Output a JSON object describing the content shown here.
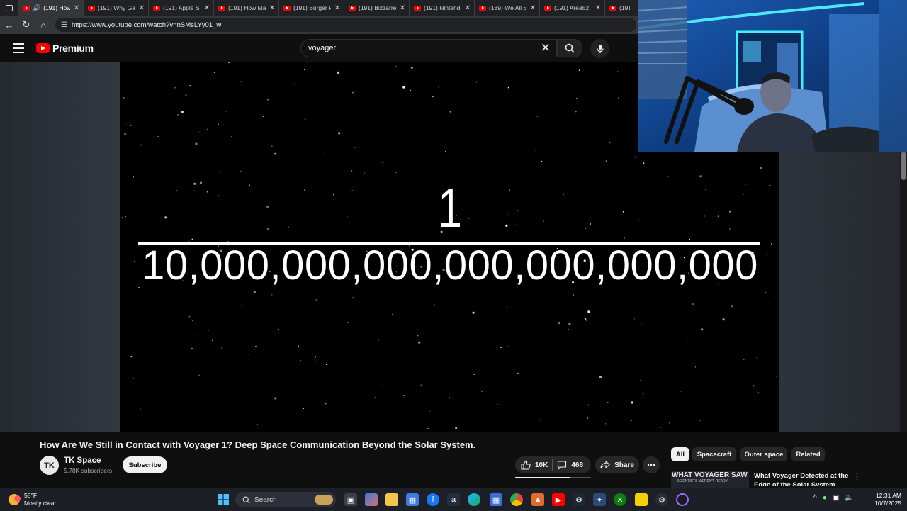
{
  "browser": {
    "tabs": [
      {
        "title": "(191) How",
        "active": true,
        "audio": true
      },
      {
        "title": "(191) Why Ga"
      },
      {
        "title": "(191) Apple S"
      },
      {
        "title": "(191) How Ma"
      },
      {
        "title": "(191) Burger P"
      },
      {
        "title": "(191) Bizzarre"
      },
      {
        "title": "(191) Nintend"
      },
      {
        "title": "(189) We All S"
      },
      {
        "title": "(191) Area52"
      },
      {
        "title": "(191)"
      }
    ],
    "url": "https://www.youtube.com/watch?v=nSMsLYy01_w"
  },
  "youtube": {
    "logo_text": "Premium",
    "search_value": "voyager"
  },
  "video": {
    "numerator": "1",
    "denominator": "10,000,000,000,000,000,000,000",
    "title": "How Are We Still in Contact with Voyager 1? Deep Space Communication Beyond the Solar System.",
    "channel": {
      "avatar_text": "TK",
      "name": "TK Space",
      "subscribers": "5.78K subscribers",
      "subscribe_label": "Subscribe"
    },
    "likes": "10K",
    "like_ratio": 0.73,
    "comments": "468",
    "share_label": "Share"
  },
  "recommendations": {
    "chips": [
      "All",
      "Spacecraft",
      "Outer space",
      "Related"
    ],
    "selected_chip": "All",
    "first": {
      "thumb_text": "WHAT VOYAGER SAW",
      "thumb_subtext": "SCIENTISTS WEREN'T READY",
      "title": "What Voyager Detected at the Edge of the Solar System"
    }
  },
  "taskbar": {
    "weather_temp": "58°F",
    "weather_desc": "Mostly clear",
    "search_label": "Search",
    "time": "12:31 AM",
    "date": "10/7/2025"
  },
  "colors": {
    "youtube_red": "#ff0000",
    "page_bg": "#0f0f0f",
    "chip_bg": "#272727"
  }
}
